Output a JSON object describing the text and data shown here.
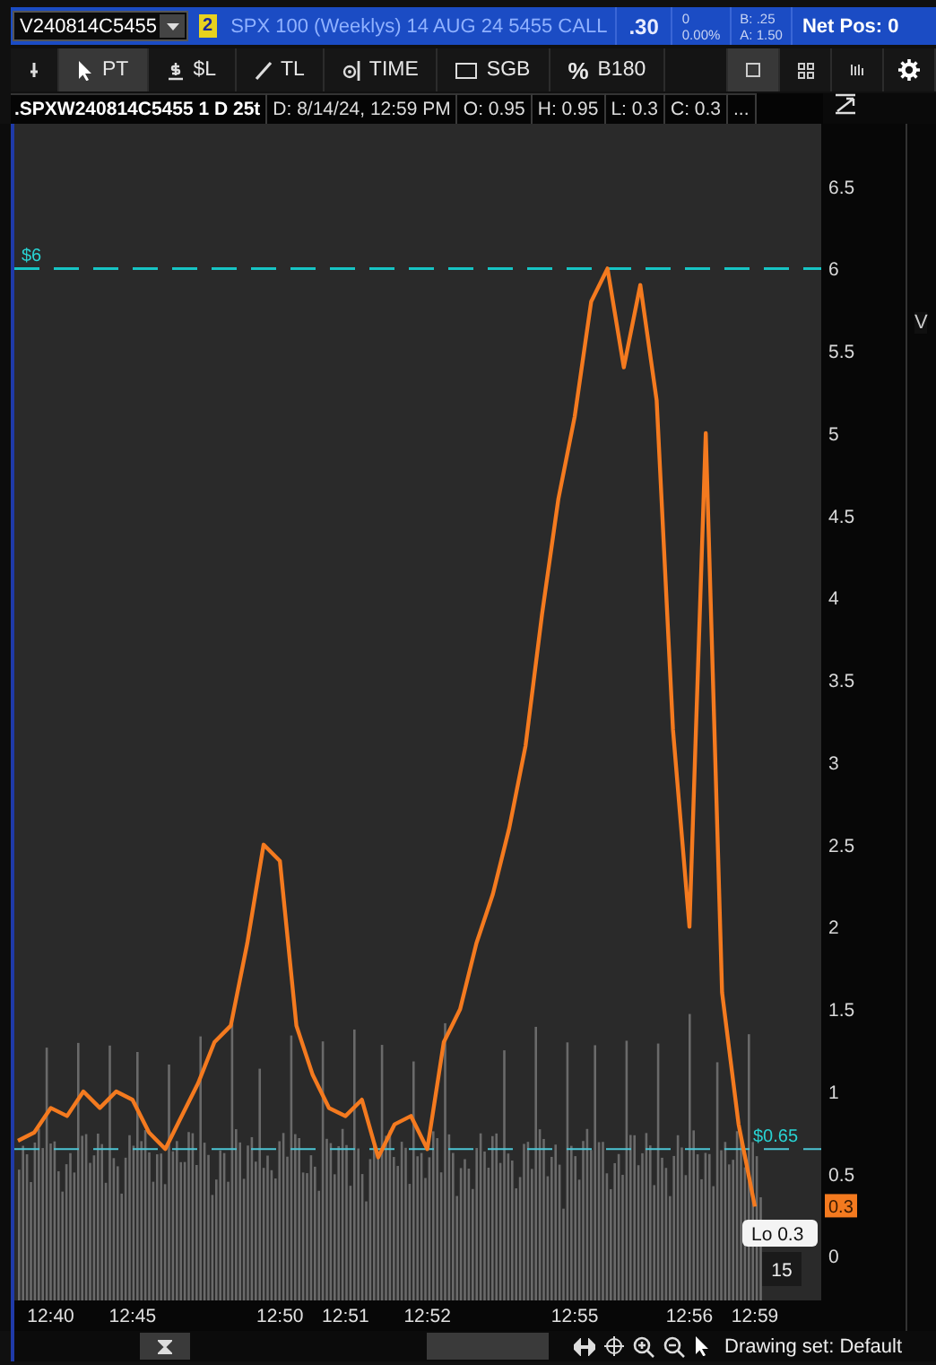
{
  "quote_bar": {
    "symbol": "V240814C5455",
    "badge": "2",
    "description": "SPX 100 (Weeklys) 14 AUG 24 5455 CALL",
    "last": ".30",
    "change": "0",
    "change_percent": "0.00%",
    "bid": "B: .25",
    "ask": "A: 1.50",
    "net_position": "Net Pos: 0"
  },
  "toolbar": {
    "tools": [
      {
        "kind": "pin",
        "selected": false
      },
      {
        "kind": "pointer",
        "label": "PT",
        "selected": true
      },
      {
        "kind": "dollar",
        "label": "$L",
        "selected": false
      },
      {
        "kind": "line",
        "label": "TL",
        "selected": false
      },
      {
        "kind": "time",
        "label": "TIME",
        "selected": false
      },
      {
        "kind": "box",
        "label": "SGB",
        "selected": false
      },
      {
        "kind": "percent",
        "glyph": "%",
        "label": "B180",
        "selected": false
      }
    ],
    "layout_buttons": [
      {
        "kind": "single",
        "selected": true
      },
      {
        "kind": "grid",
        "selected": false
      },
      {
        "kind": "bars",
        "selected": false
      },
      {
        "kind": "settings",
        "selected": false
      }
    ]
  },
  "info_bar": {
    "title": ".SPXW240814C5455 1 D 25t",
    "fields": [
      "D: 8/14/24, 12:59 PM",
      "O: 0.95",
      "H: 0.95",
      "L: 0.3",
      "C: 0.3",
      "..."
    ]
  },
  "chart": {
    "chart_data": {
      "type": "line",
      "categories": [
        null,
        null,
        "12:40",
        null,
        null,
        null,
        null,
        "12:45",
        null,
        null,
        null,
        null,
        null,
        null,
        null,
        null,
        "12:50",
        null,
        null,
        null,
        "12:51",
        null,
        null,
        null,
        null,
        "12:52",
        null,
        null,
        null,
        null,
        null,
        null,
        null,
        null,
        "12:55",
        null,
        null,
        null,
        null,
        null,
        null,
        "12:56",
        null,
        null,
        null,
        "12:59"
      ],
      "series": [
        {
          "color": "#f47a1f",
          "values": [
            0.7,
            0.75,
            0.9,
            0.85,
            1.0,
            0.9,
            1.0,
            0.95,
            0.75,
            0.65,
            0.85,
            1.05,
            1.3,
            1.4,
            1.9,
            2.5,
            2.4,
            1.4,
            1.1,
            0.9,
            0.85,
            0.95,
            0.6,
            0.8,
            0.85,
            0.65,
            1.3,
            1.5,
            1.9,
            2.2,
            2.6,
            3.1,
            3.9,
            4.6,
            5.1,
            5.8,
            6.0,
            5.4,
            5.9,
            5.2,
            3.2,
            2.0,
            5.0,
            1.6,
            0.8,
            0.3
          ]
        }
      ],
      "ylim": [
        -0.27,
        6.88
      ],
      "yticks": [
        0,
        0.5,
        1,
        1.5,
        2,
        2.5,
        3,
        3.5,
        4,
        4.5,
        5,
        5.5,
        6,
        6.5
      ],
      "ref_lines": [
        {
          "axis": "y",
          "value": 6,
          "label": "$6"
        },
        {
          "axis": "y",
          "value": 0.65,
          "label": "$0.65"
        }
      ]
    },
    "price_marker": "0.3",
    "tooltip": "Lo 0.3",
    "volume_tooltip": "15"
  },
  "side_panel": {
    "text": "V"
  },
  "bottom_bar": {
    "drawing_set": "Drawing set: Default"
  }
}
